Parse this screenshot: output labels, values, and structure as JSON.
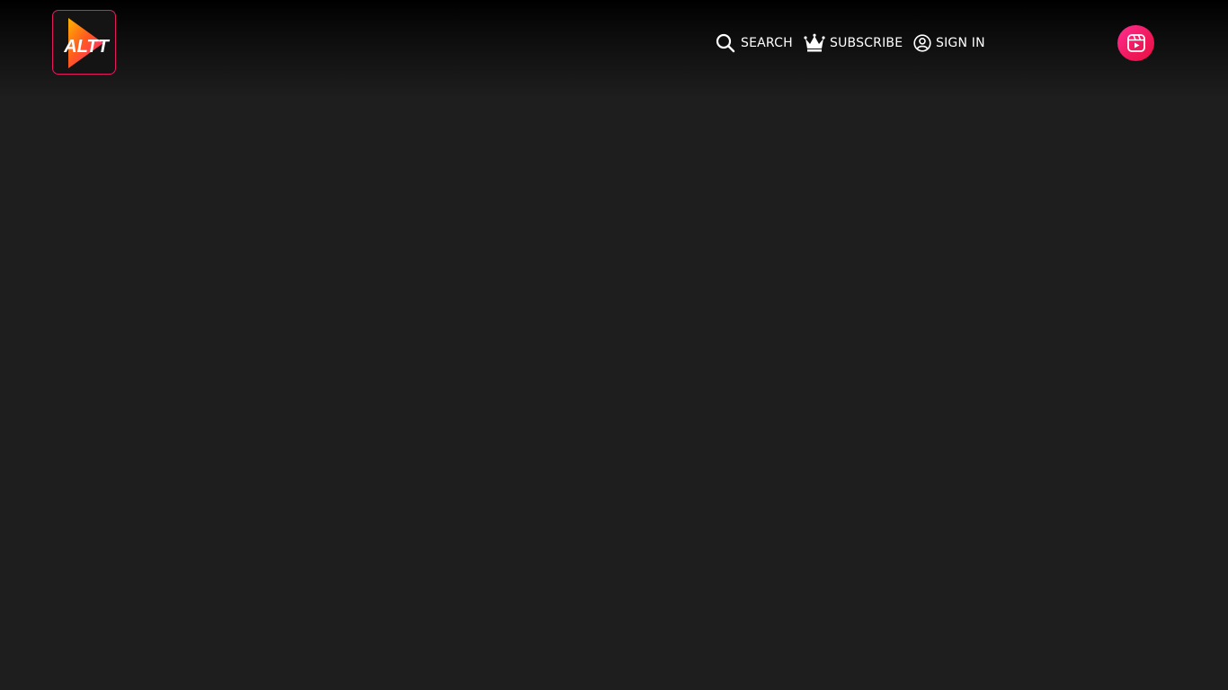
{
  "header": {
    "logo": {
      "text": "ALTT",
      "icon": "play-triangle-logo-icon"
    },
    "nav": {
      "search_label": "SEARCH",
      "subscribe_label": "SUBSCRIBE",
      "signin_label": "SIGN IN"
    },
    "shorts_button": {
      "icon": "video-reel-icon"
    }
  },
  "colors": {
    "background": "#1e1e1e",
    "accent": "#e8195f",
    "text": "#ffffff"
  }
}
